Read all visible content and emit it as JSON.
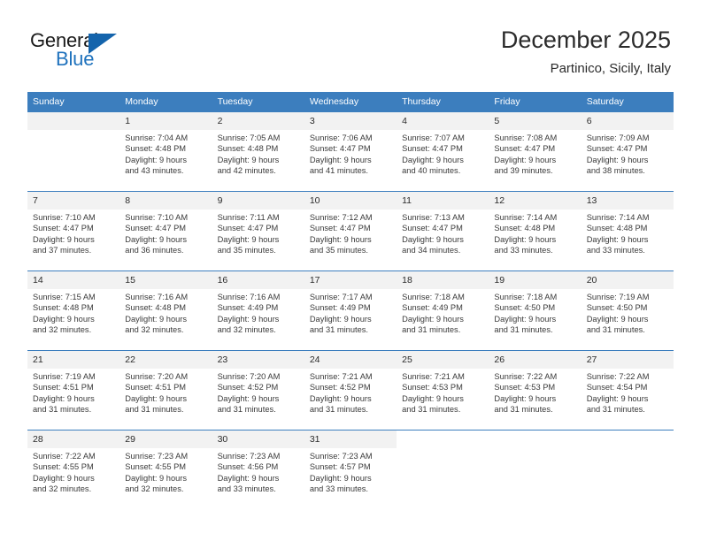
{
  "brand": {
    "name_part1": "General",
    "name_part2": "Blue",
    "flag_icon": "triangle-flag-icon",
    "accent_color": "#1f72bd"
  },
  "header": {
    "title": "December 2025",
    "subtitle": "Partinico, Sicily, Italy"
  },
  "theme": {
    "header_row_bg": "#3c7ebe",
    "daynum_bg": "#f2f2f2",
    "text_color": "#3a3a3a"
  },
  "weekday_headers": [
    "Sunday",
    "Monday",
    "Tuesday",
    "Wednesday",
    "Thursday",
    "Friday",
    "Saturday"
  ],
  "weeks": [
    [
      {
        "day": "",
        "sunrise": "",
        "sunset": "",
        "daylight1": "",
        "daylight2": "",
        "empty": true
      },
      {
        "day": "1",
        "sunrise": "Sunrise: 7:04 AM",
        "sunset": "Sunset: 4:48 PM",
        "daylight1": "Daylight: 9 hours",
        "daylight2": "and 43 minutes."
      },
      {
        "day": "2",
        "sunrise": "Sunrise: 7:05 AM",
        "sunset": "Sunset: 4:48 PM",
        "daylight1": "Daylight: 9 hours",
        "daylight2": "and 42 minutes."
      },
      {
        "day": "3",
        "sunrise": "Sunrise: 7:06 AM",
        "sunset": "Sunset: 4:47 PM",
        "daylight1": "Daylight: 9 hours",
        "daylight2": "and 41 minutes."
      },
      {
        "day": "4",
        "sunrise": "Sunrise: 7:07 AM",
        "sunset": "Sunset: 4:47 PM",
        "daylight1": "Daylight: 9 hours",
        "daylight2": "and 40 minutes."
      },
      {
        "day": "5",
        "sunrise": "Sunrise: 7:08 AM",
        "sunset": "Sunset: 4:47 PM",
        "daylight1": "Daylight: 9 hours",
        "daylight2": "and 39 minutes."
      },
      {
        "day": "6",
        "sunrise": "Sunrise: 7:09 AM",
        "sunset": "Sunset: 4:47 PM",
        "daylight1": "Daylight: 9 hours",
        "daylight2": "and 38 minutes."
      }
    ],
    [
      {
        "day": "7",
        "sunrise": "Sunrise: 7:10 AM",
        "sunset": "Sunset: 4:47 PM",
        "daylight1": "Daylight: 9 hours",
        "daylight2": "and 37 minutes."
      },
      {
        "day": "8",
        "sunrise": "Sunrise: 7:10 AM",
        "sunset": "Sunset: 4:47 PM",
        "daylight1": "Daylight: 9 hours",
        "daylight2": "and 36 minutes."
      },
      {
        "day": "9",
        "sunrise": "Sunrise: 7:11 AM",
        "sunset": "Sunset: 4:47 PM",
        "daylight1": "Daylight: 9 hours",
        "daylight2": "and 35 minutes."
      },
      {
        "day": "10",
        "sunrise": "Sunrise: 7:12 AM",
        "sunset": "Sunset: 4:47 PM",
        "daylight1": "Daylight: 9 hours",
        "daylight2": "and 35 minutes."
      },
      {
        "day": "11",
        "sunrise": "Sunrise: 7:13 AM",
        "sunset": "Sunset: 4:47 PM",
        "daylight1": "Daylight: 9 hours",
        "daylight2": "and 34 minutes."
      },
      {
        "day": "12",
        "sunrise": "Sunrise: 7:14 AM",
        "sunset": "Sunset: 4:48 PM",
        "daylight1": "Daylight: 9 hours",
        "daylight2": "and 33 minutes."
      },
      {
        "day": "13",
        "sunrise": "Sunrise: 7:14 AM",
        "sunset": "Sunset: 4:48 PM",
        "daylight1": "Daylight: 9 hours",
        "daylight2": "and 33 minutes."
      }
    ],
    [
      {
        "day": "14",
        "sunrise": "Sunrise: 7:15 AM",
        "sunset": "Sunset: 4:48 PM",
        "daylight1": "Daylight: 9 hours",
        "daylight2": "and 32 minutes."
      },
      {
        "day": "15",
        "sunrise": "Sunrise: 7:16 AM",
        "sunset": "Sunset: 4:48 PM",
        "daylight1": "Daylight: 9 hours",
        "daylight2": "and 32 minutes."
      },
      {
        "day": "16",
        "sunrise": "Sunrise: 7:16 AM",
        "sunset": "Sunset: 4:49 PM",
        "daylight1": "Daylight: 9 hours",
        "daylight2": "and 32 minutes."
      },
      {
        "day": "17",
        "sunrise": "Sunrise: 7:17 AM",
        "sunset": "Sunset: 4:49 PM",
        "daylight1": "Daylight: 9 hours",
        "daylight2": "and 31 minutes."
      },
      {
        "day": "18",
        "sunrise": "Sunrise: 7:18 AM",
        "sunset": "Sunset: 4:49 PM",
        "daylight1": "Daylight: 9 hours",
        "daylight2": "and 31 minutes."
      },
      {
        "day": "19",
        "sunrise": "Sunrise: 7:18 AM",
        "sunset": "Sunset: 4:50 PM",
        "daylight1": "Daylight: 9 hours",
        "daylight2": "and 31 minutes."
      },
      {
        "day": "20",
        "sunrise": "Sunrise: 7:19 AM",
        "sunset": "Sunset: 4:50 PM",
        "daylight1": "Daylight: 9 hours",
        "daylight2": "and 31 minutes."
      }
    ],
    [
      {
        "day": "21",
        "sunrise": "Sunrise: 7:19 AM",
        "sunset": "Sunset: 4:51 PM",
        "daylight1": "Daylight: 9 hours",
        "daylight2": "and 31 minutes."
      },
      {
        "day": "22",
        "sunrise": "Sunrise: 7:20 AM",
        "sunset": "Sunset: 4:51 PM",
        "daylight1": "Daylight: 9 hours",
        "daylight2": "and 31 minutes."
      },
      {
        "day": "23",
        "sunrise": "Sunrise: 7:20 AM",
        "sunset": "Sunset: 4:52 PM",
        "daylight1": "Daylight: 9 hours",
        "daylight2": "and 31 minutes."
      },
      {
        "day": "24",
        "sunrise": "Sunrise: 7:21 AM",
        "sunset": "Sunset: 4:52 PM",
        "daylight1": "Daylight: 9 hours",
        "daylight2": "and 31 minutes."
      },
      {
        "day": "25",
        "sunrise": "Sunrise: 7:21 AM",
        "sunset": "Sunset: 4:53 PM",
        "daylight1": "Daylight: 9 hours",
        "daylight2": "and 31 minutes."
      },
      {
        "day": "26",
        "sunrise": "Sunrise: 7:22 AM",
        "sunset": "Sunset: 4:53 PM",
        "daylight1": "Daylight: 9 hours",
        "daylight2": "and 31 minutes."
      },
      {
        "day": "27",
        "sunrise": "Sunrise: 7:22 AM",
        "sunset": "Sunset: 4:54 PM",
        "daylight1": "Daylight: 9 hours",
        "daylight2": "and 31 minutes."
      }
    ],
    [
      {
        "day": "28",
        "sunrise": "Sunrise: 7:22 AM",
        "sunset": "Sunset: 4:55 PM",
        "daylight1": "Daylight: 9 hours",
        "daylight2": "and 32 minutes."
      },
      {
        "day": "29",
        "sunrise": "Sunrise: 7:23 AM",
        "sunset": "Sunset: 4:55 PM",
        "daylight1": "Daylight: 9 hours",
        "daylight2": "and 32 minutes."
      },
      {
        "day": "30",
        "sunrise": "Sunrise: 7:23 AM",
        "sunset": "Sunset: 4:56 PM",
        "daylight1": "Daylight: 9 hours",
        "daylight2": "and 33 minutes."
      },
      {
        "day": "31",
        "sunrise": "Sunrise: 7:23 AM",
        "sunset": "Sunset: 4:57 PM",
        "daylight1": "Daylight: 9 hours",
        "daylight2": "and 33 minutes."
      },
      {
        "day": "",
        "sunrise": "",
        "sunset": "",
        "daylight1": "",
        "daylight2": "",
        "empty": true,
        "nofill": true
      },
      {
        "day": "",
        "sunrise": "",
        "sunset": "",
        "daylight1": "",
        "daylight2": "",
        "empty": true,
        "nofill": true
      },
      {
        "day": "",
        "sunrise": "",
        "sunset": "",
        "daylight1": "",
        "daylight2": "",
        "empty": true,
        "nofill": true
      }
    ]
  ]
}
